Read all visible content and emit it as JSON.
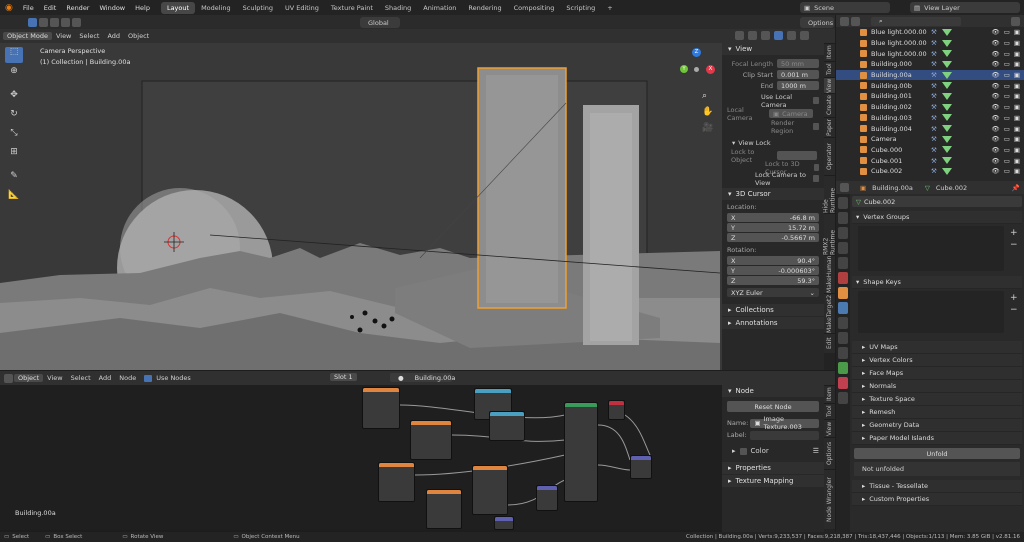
{
  "menu": [
    "File",
    "Edit",
    "Render",
    "Window",
    "Help"
  ],
  "workspaces": [
    "Layout",
    "Modeling",
    "Sculpting",
    "UV Editing",
    "Texture Paint",
    "Shading",
    "Animation",
    "Rendering",
    "Compositing",
    "Scripting"
  ],
  "workspace_add": "+",
  "scene": {
    "name": "Scene",
    "view_layer": "View Layer"
  },
  "viewport_header": {
    "mode": "Object Mode",
    "menus": [
      "View",
      "Select",
      "Add",
      "Object"
    ],
    "orientation": "Global",
    "options": "Options"
  },
  "viewport_overlay": {
    "line1": "Camera Perspective",
    "line2": "(1) Collection | Building.00a"
  },
  "gizmo": {
    "z": "Z",
    "y": "Y",
    "x": "X"
  },
  "sidebar_view": {
    "panel": "View",
    "focal_length_label": "Focal Length",
    "focal_length": "50 mm",
    "clip_start_label": "Clip Start",
    "clip_start": "0.001 m",
    "end_label": "End",
    "end": "1000 m",
    "use_local_camera": "Use Local Camera",
    "local_camera_label": "Local Camera",
    "local_camera": "Camera",
    "render_region": "Render Region",
    "view_lock": "View Lock",
    "lock_to_object": "Lock to Object",
    "lock_to_3d_cursor": "Lock to 3D Cursor",
    "lock_camera_to_view": "Lock Camera to View",
    "cursor_panel": "3D Cursor",
    "location_label": "Location:",
    "loc_x": "-66.8 m",
    "loc_y": "15.72 m",
    "loc_z": "-0.5667 m",
    "rotation_label": "Rotation:",
    "rot_x": "90.4°",
    "rot_y": "-0.000603°",
    "rot_z": "59.3°",
    "rotation_mode": "XYZ Euler",
    "collections": "Collections",
    "annotations": "Annotations"
  },
  "vtabs_top": [
    "Item",
    "Tool",
    "View",
    "Create",
    "Paper",
    "Operator",
    "Hide Runtime",
    "RMX2 Runtime",
    "MakeHuman",
    "MakeTarget2",
    "Edit"
  ],
  "vtabs_bottom": [
    "Item",
    "Tool",
    "View",
    "Options",
    "Node Wrangler"
  ],
  "outliner": {
    "rows": [
      {
        "name": "Blue light.000.007",
        "selected": false
      },
      {
        "name": "Blue light.000.008",
        "selected": false
      },
      {
        "name": "Blue light.000.009",
        "selected": false
      },
      {
        "name": "Building.000",
        "selected": false
      },
      {
        "name": "Building.00a",
        "selected": true
      },
      {
        "name": "Building.00b",
        "selected": false
      },
      {
        "name": "Building.001",
        "selected": false
      },
      {
        "name": "Building.002",
        "selected": false
      },
      {
        "name": "Building.003",
        "selected": false
      },
      {
        "name": "Building.004",
        "selected": false
      },
      {
        "name": "Camera",
        "selected": false
      },
      {
        "name": "Cube.000",
        "selected": false
      },
      {
        "name": "Cube.001",
        "selected": false
      },
      {
        "name": "Cube.002",
        "selected": false
      }
    ]
  },
  "properties": {
    "object": "Building.00a",
    "mesh": "Cube.002",
    "mesh_field": "Cube.002",
    "vertex_groups": "Vertex Groups",
    "shape_keys": "Shape Keys",
    "sections": [
      "UV Maps",
      "Vertex Colors",
      "Face Maps",
      "Normals",
      "Texture Space",
      "Remesh",
      "Geometry Data",
      "Paper Model Islands"
    ],
    "unfold_btn": "Unfold",
    "not_unfolded": "Not unfolded",
    "tissue": "Tissue - Tessellate",
    "custom_props": "Custom Properties"
  },
  "node_header": {
    "type": "Object",
    "menus": [
      "View",
      "Select",
      "Add",
      "Node"
    ],
    "use_nodes": "Use Nodes",
    "slot": "Slot 1",
    "material": "Building.00a"
  },
  "node_panel": {
    "panel": "Node",
    "reset": "Reset Node",
    "name_label": "Name:",
    "name": "Image Texture.003",
    "label_label": "Label:",
    "color": "Color",
    "properties": "Properties",
    "texture_mapping": "Texture Mapping"
  },
  "node_material_label": "Building.00a",
  "status": {
    "left": [
      "Select",
      "Box Select",
      "Rotate View",
      "Object Context Menu"
    ],
    "right": "Collection | Building.00a | Verts:9,233,537 | Faces:9,218,387 | Tris:18,437,446 | Objects:1/113 | Mem: 3.85 GiB | v2.81.16"
  },
  "colors": {
    "accent": "#4772b3",
    "selected_row": "#334d80",
    "active_outline": "#f0a030",
    "header": "#303030",
    "background": "#1d1d1d"
  }
}
